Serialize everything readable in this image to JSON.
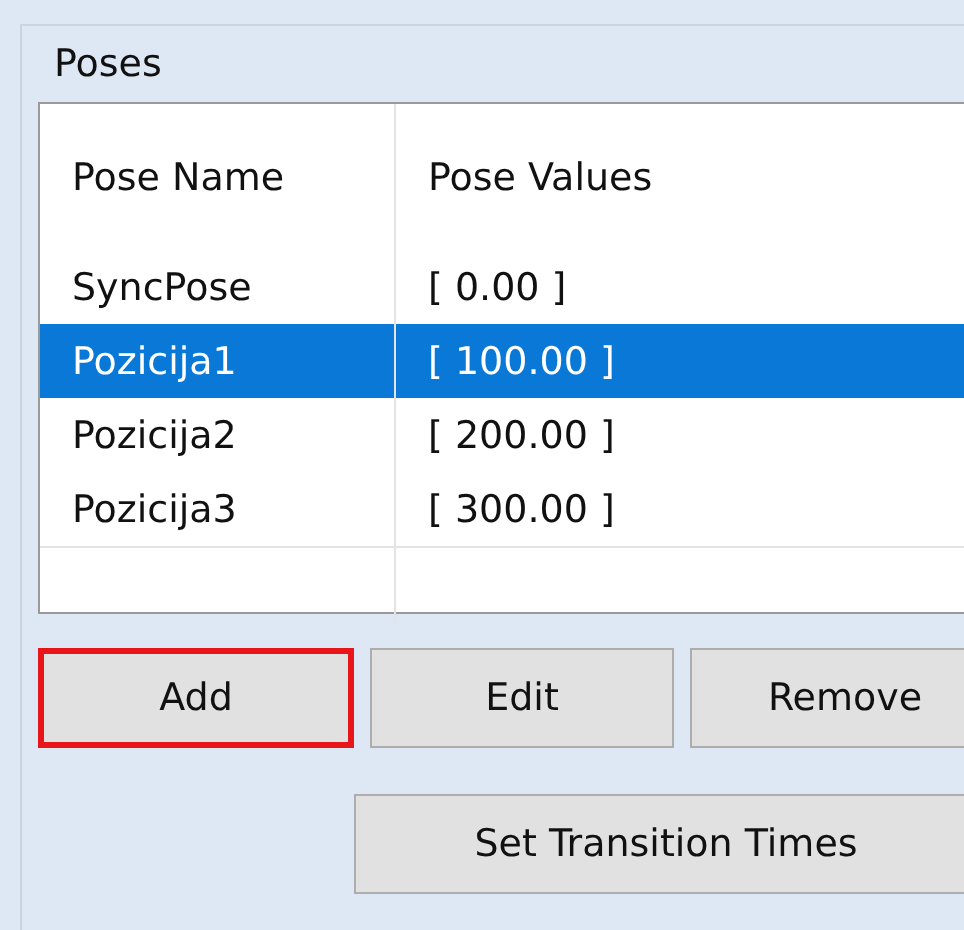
{
  "group": {
    "title": "Poses"
  },
  "table": {
    "columns": [
      "Pose Name",
      "Pose Values"
    ],
    "rows": [
      {
        "name": "SyncPose",
        "values": "[ 0.00 ]",
        "selected": false
      },
      {
        "name": "Pozicija1",
        "values": "[ 100.00 ]",
        "selected": true
      },
      {
        "name": "Pozicija2",
        "values": "[ 200.00 ]",
        "selected": false
      },
      {
        "name": "Pozicija3",
        "values": "[ 300.00 ]",
        "selected": false
      }
    ]
  },
  "buttons": [
    {
      "label": "Add",
      "highlighted": true
    },
    {
      "label": "Edit",
      "highlighted": false
    },
    {
      "label": "Remove",
      "highlighted": false
    }
  ],
  "transition_button": {
    "label": "Set Transition Times",
    "highlighted": false
  }
}
